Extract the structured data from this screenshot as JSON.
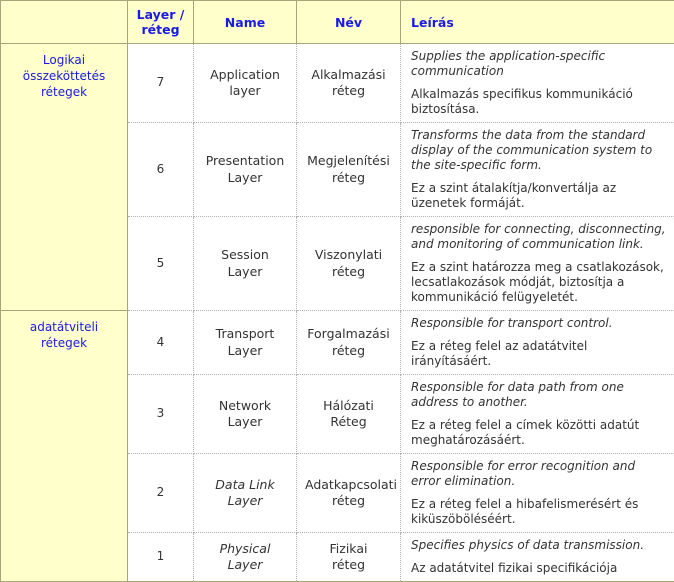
{
  "table": {
    "headers": {
      "group": "",
      "layer": "Layer /\nréteg",
      "layer_line1": "Layer /",
      "layer_line2": "réteg",
      "name": "Name",
      "nev": "Név",
      "leiras": "Leírás"
    },
    "groups": [
      {
        "label_line1": "Logikai",
        "label_line2": "összeköttetés",
        "label_line3": "rétegek",
        "span": 3
      },
      {
        "label_line1": "adatátviteli",
        "label_line2": "rétegek",
        "span": 4
      }
    ],
    "rows": [
      {
        "group_index": 0,
        "layer": "7",
        "name_line1": "Application",
        "name_line2": "layer",
        "name_italic": false,
        "nev_line1": "Alkalmazási",
        "nev_line2": "réteg",
        "desc_en": "Supplies the application-specific communication",
        "desc_hu": "Alkalmazás specifikus kommunikáció biztosítása."
      },
      {
        "group_index": 0,
        "layer": "6",
        "name_line1": "Presentation",
        "name_line2": "Layer",
        "name_italic": false,
        "nev_line1": "Megjelenítési",
        "nev_line2": "réteg",
        "desc_en": "Transforms the data from the standard display of the communication system to the site-specific form.",
        "desc_hu": "Ez a szint átalakítja/konvertálja az üzenetek formáját."
      },
      {
        "group_index": 0,
        "layer": "5",
        "name_line1": "Session",
        "name_line2": "Layer",
        "name_italic": false,
        "nev_line1": "Viszonylati",
        "nev_line2": "réteg",
        "desc_en": "responsible for connecting, disconnecting, and monitoring of communication link.",
        "desc_hu": "Ez a szint határozza meg a csatlakozások, lecsatlakozások módját, biztosítja a kommunikáció felügyeletét."
      },
      {
        "group_index": 1,
        "layer": "4",
        "name_line1": "Transport",
        "name_line2": "Layer",
        "name_italic": false,
        "nev_line1": "Forgalmazási",
        "nev_line2": "réteg",
        "desc_en": "Responsible for transport control.",
        "desc_hu": "Ez a réteg felel az adatátvitel irányításáért."
      },
      {
        "group_index": 1,
        "layer": "3",
        "name_line1": "Network",
        "name_line2": "Layer",
        "name_italic": false,
        "nev_line1": "Hálózati",
        "nev_line2": "Réteg",
        "desc_en": "Responsible for data path from one address to another.",
        "desc_hu": "Ez a réteg felel a címek közötti adatút meghatározásáért."
      },
      {
        "group_index": 1,
        "layer": "2",
        "name_line1": "Data Link",
        "name_line2": "Layer",
        "name_italic": true,
        "nev_line1": "Adatkapcsolati",
        "nev_line2": "réteg",
        "desc_en": "Responsible for error recognition and error elimination.",
        "desc_hu": "Ez a réteg felel a hibafelismerésért és kiküszöböléséért."
      },
      {
        "group_index": 1,
        "layer": "1",
        "name_line1": "Physical",
        "name_line2": "Layer",
        "name_italic": true,
        "nev_line1": "Fizikai",
        "nev_line2": "réteg",
        "desc_en": "Specifies physics of data transmission.",
        "desc_hu": "Az adatátvitel fizikai specifikációja"
      }
    ]
  },
  "colors": {
    "header_bg": "#ffffcc",
    "header_text": "#1a1ae6",
    "group_bg": "#ffffcc",
    "group_text": "#1a1ae6",
    "body_bg": "#ffffff",
    "body_text": "#333333",
    "outer_border": "#a6a67a",
    "inner_border": "#b0b0b0"
  }
}
